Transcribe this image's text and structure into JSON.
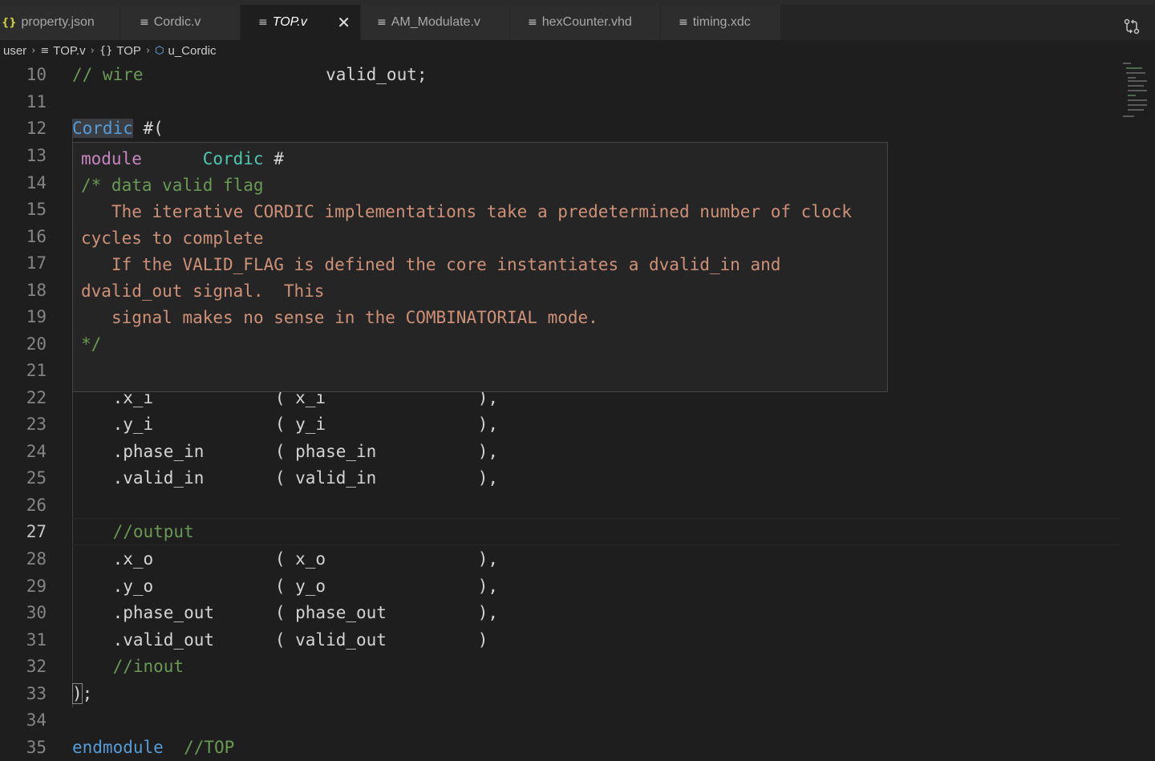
{
  "tabs": [
    {
      "label": "property.json",
      "icon": "json-icon",
      "glyph": "{}"
    },
    {
      "label": "Cordic.v",
      "icon": "file-lines-icon",
      "glyph": "≡"
    },
    {
      "label": "TOP.v",
      "icon": "file-lines-icon",
      "glyph": "≡",
      "active": true
    },
    {
      "label": "AM_Modulate.v",
      "icon": "file-lines-icon",
      "glyph": "≡"
    },
    {
      "label": "hexCounter.vhd",
      "icon": "file-lines-icon",
      "glyph": "≡"
    },
    {
      "label": "timing.xdc",
      "icon": "file-lines-icon",
      "glyph": "≡"
    }
  ],
  "tab_close_glyph": "✕",
  "breadcrumb": [
    {
      "label": "user",
      "icon": ""
    },
    {
      "label": "TOP.v",
      "icon": "≡"
    },
    {
      "label": "TOP",
      "icon": "{}"
    },
    {
      "label": "u_Cordic",
      "icon": "⬡"
    }
  ],
  "breadcrumb_sep": "›",
  "hover": {
    "signature_keyword": "module",
    "signature_name": "Cordic",
    "signature_suffix": " #",
    "comment_open": "/* data valid flag",
    "doc_line1": "\n   The iterative CORDIC implementations take a predetermined number of clock cycles to complete\n   If the VALID_FLAG is defined the core instantiates a dvalid_in and dvalid_out signal.  This\n   signal makes no sense in the COMBINATORIAL mode.",
    "comment_close": "*/"
  },
  "lines": {
    "n10": "10",
    "n11": "11",
    "n12": "12",
    "n13": "13",
    "n14": "14",
    "n15": "15",
    "n16": "16",
    "n17": "17",
    "n18": "18",
    "n19": "19",
    "n20": "20",
    "n21": "21",
    "n22": "22",
    "n23": "23",
    "n24": "24",
    "n25": "25",
    "n26": "26",
    "n27": "27",
    "n28": "28",
    "n29": "29",
    "n30": "30",
    "n31": "31",
    "n32": "32",
    "n33": "33",
    "n34": "34",
    "n35": "35",
    "l10_comment": "// wire                  ",
    "l10_rest": "valid_out;",
    "l12_ident": "Cordic",
    "l12_rest": " #(",
    "l22": "    .x_i            ( x_i               ),",
    "l23": "    .y_i            ( y_i               ),",
    "l24": "    .phase_in       ( phase_in          ),",
    "l25": "    .valid_in       ( valid_in          ),",
    "l27": "    //output",
    "l28": "    .x_o            ( x_o               ),",
    "l29": "    .y_o            ( y_o               ),",
    "l30": "    .phase_out      ( phase_out         ),",
    "l31": "    .valid_out      ( valid_out         )",
    "l32": "    //inout",
    "l33": ");",
    "l35_kw": "endmodule",
    "l35_cmt": "  //TOP"
  }
}
